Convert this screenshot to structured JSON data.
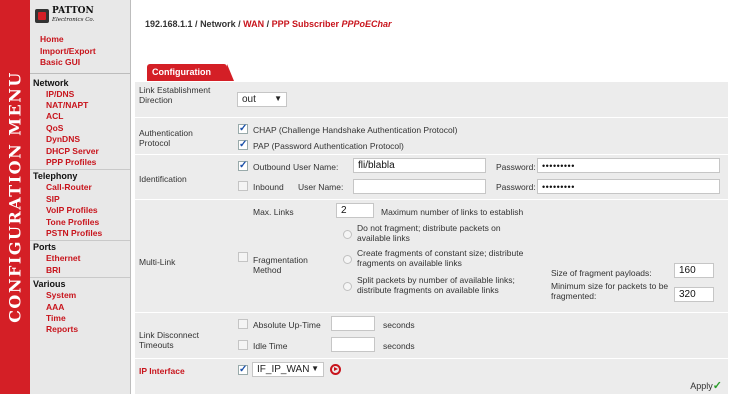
{
  "side_title": "CONFIGURATION MENU",
  "logo": {
    "name": "PATTON",
    "sub": "Electronics Co."
  },
  "nav_top": [
    "Home",
    "Import/Export",
    "Basic GUI"
  ],
  "nav": {
    "network_label": "Network",
    "network": [
      "IP/DNS",
      "NAT/NAPT",
      "ACL",
      "QoS",
      "DynDNS",
      "DHCP Server",
      "PPP Profiles"
    ],
    "telephony_label": "Telephony",
    "telephony": [
      "Call-Router",
      "SIP",
      "VoIP Profiles",
      "Tone Profiles",
      "PSTN Profiles"
    ],
    "ports_label": "Ports",
    "ports": [
      "Ethernet",
      "BRI"
    ],
    "various_label": "Various",
    "various": [
      "System",
      "AAA",
      "Time",
      "Reports"
    ]
  },
  "breadcrumb": {
    "ip": "192.168.1.1",
    "sep": " / ",
    "network": "Network",
    "wan": "WAN",
    "ppp": "PPP Subscriber",
    "current": "PPPoEChar"
  },
  "tab_label": "Configuration",
  "link_est": {
    "label": "Link Establishment Direction",
    "value": "out"
  },
  "auth": {
    "label": "Authentication Protocol",
    "chap": "CHAP (Challenge Handshake Authentication Protocol)",
    "pap": "PAP (Password Authentication Protocol)"
  },
  "ident": {
    "label": "Identification",
    "outbound": "Outbound",
    "user_name_label": "User Name:",
    "outbound_user": "fli/blabla",
    "password_label": "Password:",
    "outbound_password": "•••••••••",
    "inbound": "Inbound",
    "inbound_user": "",
    "inbound_password": "•••••••••"
  },
  "multilink": {
    "label": "Multi-Link",
    "max_links_label": "Max. Links",
    "max_links": "2",
    "max_links_desc": "Maximum number of links to establish",
    "frag_label": "Fragmentation Method",
    "opt1": "Do not fragment; distribute packets on available links",
    "opt2": "Create fragments of constant size; distribute fragments on available links",
    "opt3": "Split packets by number of available links; distribute fragments on available links",
    "frag_size_label": "Size of fragment payloads:",
    "frag_size": "160",
    "min_size_label": "Minimum size for packets to be fragmented:",
    "min_size": "320"
  },
  "timeouts": {
    "label": "Link Disconnect Timeouts",
    "absolute": "Absolute Up-Time",
    "idle": "Idle Time",
    "unit": "seconds",
    "absolute_value": "",
    "idle_value": ""
  },
  "ip_interface": {
    "label": "IP Interface",
    "value": "IF_IP_WAN"
  },
  "apply_label": "Apply",
  "colors": {
    "accent": "#d41f26",
    "link": "#c8141c",
    "panel": "#ececec",
    "sidebar": "#e8e8e8"
  }
}
